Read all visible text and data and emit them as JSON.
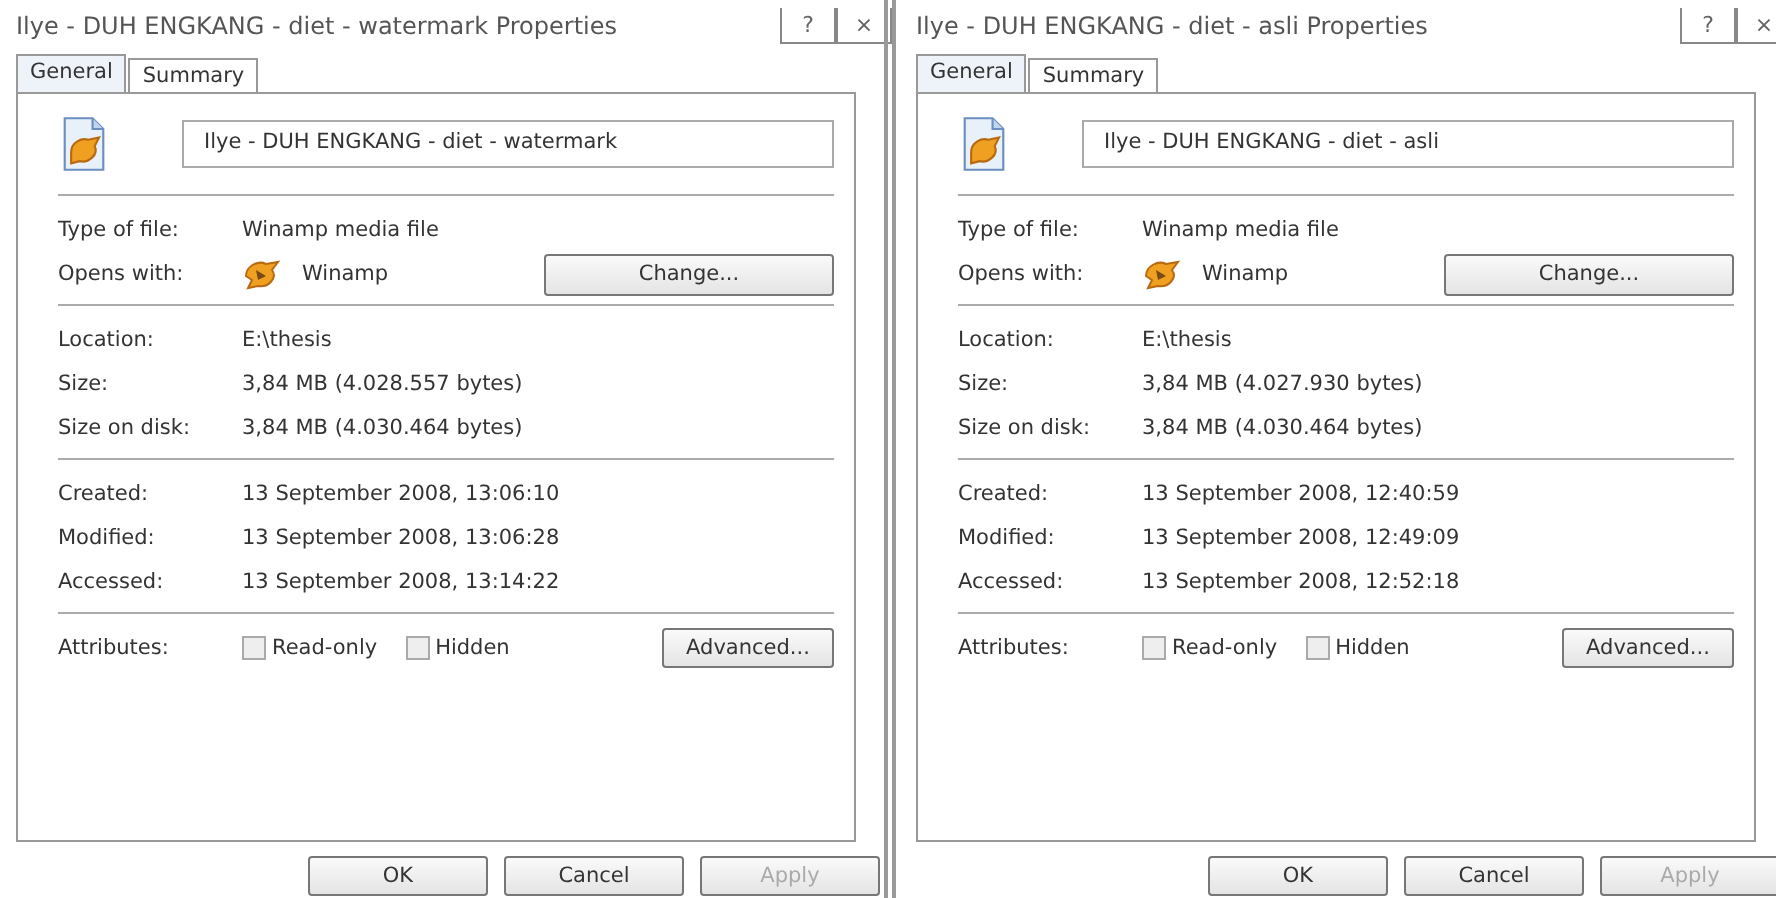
{
  "dialogs": [
    {
      "title": "Ilye - DUH ENGKANG - diet - watermark Properties",
      "title_buttons": [
        "?",
        "×"
      ],
      "tabs": [
        {
          "label": "General",
          "selected": true
        },
        {
          "label": "Summary",
          "selected": false
        }
      ],
      "file_name": "Ilye - DUH ENGKANG - diet - watermark",
      "sections": [
        [
          {
            "kind": "text",
            "label": "Type of file:",
            "value": "Winamp media file"
          },
          {
            "kind": "app",
            "label": "Opens with:",
            "value": "Winamp",
            "button": "Change..."
          }
        ],
        [
          {
            "kind": "text",
            "label": "Location:",
            "value": "E:\\thesis"
          },
          {
            "kind": "text",
            "label": "Size:",
            "value": "3,84 MB (4.028.557 bytes)"
          },
          {
            "kind": "text",
            "label": "Size on disk:",
            "value": "3,84 MB (4.030.464 bytes)"
          }
        ],
        [
          {
            "kind": "text",
            "label": "Created:",
            "value": "13 September 2008, 13:06:10"
          },
          {
            "kind": "text",
            "label": "Modified:",
            "value": "13 September 2008, 13:06:28"
          },
          {
            "kind": "text",
            "label": "Accessed:",
            "value": "13 September 2008, 13:14:22"
          }
        ]
      ],
      "attributes": {
        "label": "Attributes:",
        "options": [
          {
            "label": "Read-only",
            "checked": false
          },
          {
            "label": "Hidden",
            "checked": false
          }
        ],
        "button": "Advanced..."
      },
      "buttons": [
        {
          "label": "OK",
          "disabled": false
        },
        {
          "label": "Cancel",
          "disabled": false
        },
        {
          "label": "Apply",
          "disabled": true
        }
      ]
    },
    {
      "title": "Ilye - DUH ENGKANG - diet - asli Properties",
      "title_buttons": [
        "?",
        "×"
      ],
      "tabs": [
        {
          "label": "General",
          "selected": true
        },
        {
          "label": "Summary",
          "selected": false
        }
      ],
      "file_name": "Ilye - DUH ENGKANG - diet - asli",
      "sections": [
        [
          {
            "kind": "text",
            "label": "Type of file:",
            "value": "Winamp media file"
          },
          {
            "kind": "app",
            "label": "Opens with:",
            "value": "Winamp",
            "button": "Change..."
          }
        ],
        [
          {
            "kind": "text",
            "label": "Location:",
            "value": "E:\\thesis"
          },
          {
            "kind": "text",
            "label": "Size:",
            "value": "3,84 MB (4.027.930 bytes)"
          },
          {
            "kind": "text",
            "label": "Size on disk:",
            "value": "3,84 MB (4.030.464 bytes)"
          }
        ],
        [
          {
            "kind": "text",
            "label": "Created:",
            "value": "13 September 2008, 12:40:59"
          },
          {
            "kind": "text",
            "label": "Modified:",
            "value": "13 September 2008, 12:49:09"
          },
          {
            "kind": "text",
            "label": "Accessed:",
            "value": "13 September 2008, 12:52:18"
          }
        ]
      ],
      "attributes": {
        "label": "Attributes:",
        "options": [
          {
            "label": "Read-only",
            "checked": false
          },
          {
            "label": "Hidden",
            "checked": false
          }
        ],
        "button": "Advanced..."
      },
      "buttons": [
        {
          "label": "OK",
          "disabled": false
        },
        {
          "label": "Cancel",
          "disabled": false
        },
        {
          "label": "Apply",
          "disabled": true
        }
      ]
    }
  ]
}
